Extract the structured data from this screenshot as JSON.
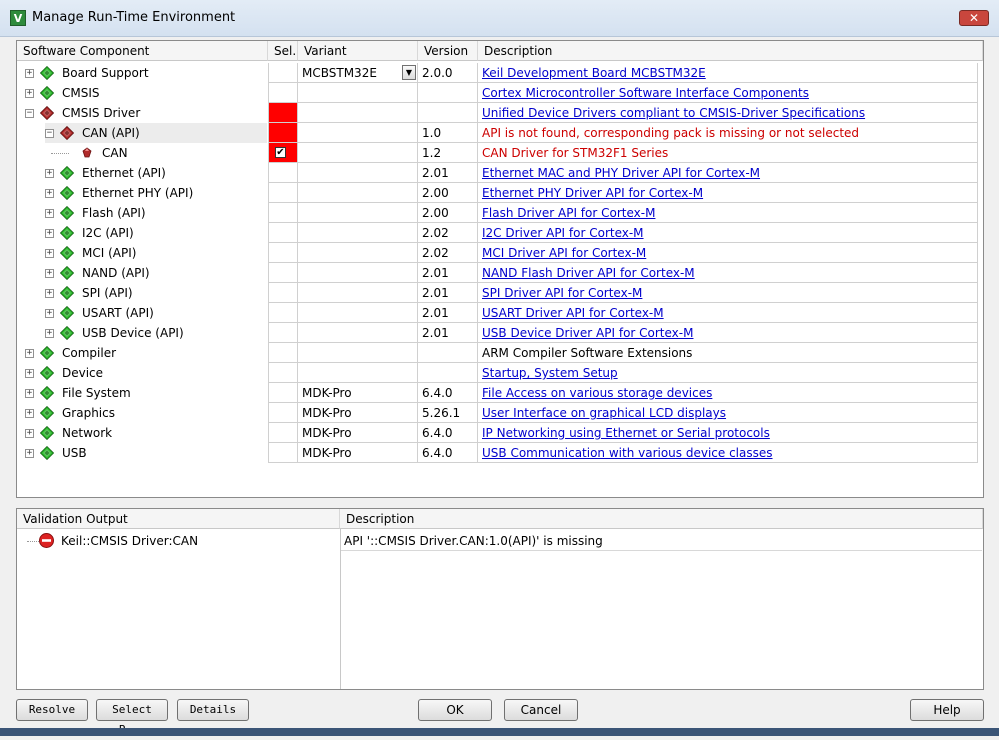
{
  "window": {
    "title": "Manage Run-Time Environment",
    "icon_letter": "V",
    "close_glyph": "✕"
  },
  "columns": {
    "component": "Software Component",
    "sel": "Sel.",
    "variant": "Variant",
    "version": "Version",
    "description": "Description"
  },
  "rows": [
    {
      "name": "Board Support",
      "level": 0,
      "expander": "+",
      "gem": "green",
      "variant": "MCBSTM32E",
      "has_combo": true,
      "version": "2.0.0",
      "description": "Keil Development Board MCBSTM32E",
      "desc_style": "link",
      "sel": ""
    },
    {
      "name": "CMSIS",
      "level": 0,
      "expander": "+",
      "gem": "green",
      "variant": "",
      "version": "",
      "description": "Cortex Microcontroller Software Interface Components",
      "desc_style": "link",
      "sel": ""
    },
    {
      "name": "CMSIS Driver",
      "level": 0,
      "expander": "−",
      "gem": "red",
      "variant": "",
      "version": "",
      "description": "Unified Device Drivers compliant to CMSIS-Driver Specifications",
      "desc_style": "link",
      "sel": "red"
    },
    {
      "name": "CAN (API)",
      "level": 1,
      "expander": "−",
      "gem": "red",
      "variant": "",
      "version": "1.0",
      "description": "API is not found, corresponding pack is missing or not selected",
      "desc_style": "error",
      "sel": "red",
      "highlight": true
    },
    {
      "name": "CAN",
      "level": 2,
      "expander": "",
      "gem": "small",
      "variant": "",
      "version": "1.2",
      "description": "CAN Driver for STM32F1 Series",
      "desc_style": "error",
      "sel": "check"
    },
    {
      "name": "Ethernet (API)",
      "level": 1,
      "expander": "+",
      "gem": "green",
      "variant": "",
      "version": "2.01",
      "description": "Ethernet MAC and PHY Driver API for Cortex-M",
      "desc_style": "link",
      "sel": ""
    },
    {
      "name": "Ethernet PHY (API)",
      "level": 1,
      "expander": "+",
      "gem": "green",
      "variant": "",
      "version": "2.00",
      "description": "Ethernet PHY Driver API for Cortex-M",
      "desc_style": "link",
      "sel": ""
    },
    {
      "name": "Flash (API)",
      "level": 1,
      "expander": "+",
      "gem": "green",
      "variant": "",
      "version": "2.00",
      "description": "Flash Driver API for Cortex-M",
      "desc_style": "link",
      "sel": ""
    },
    {
      "name": "I2C (API)",
      "level": 1,
      "expander": "+",
      "gem": "green",
      "variant": "",
      "version": "2.02",
      "description": "I2C Driver API for Cortex-M",
      "desc_style": "link",
      "sel": ""
    },
    {
      "name": "MCI (API)",
      "level": 1,
      "expander": "+",
      "gem": "green",
      "variant": "",
      "version": "2.02",
      "description": "MCI Driver API for Cortex-M",
      "desc_style": "link",
      "sel": ""
    },
    {
      "name": "NAND (API)",
      "level": 1,
      "expander": "+",
      "gem": "green",
      "variant": "",
      "version": "2.01",
      "description": "NAND Flash Driver API for Cortex-M",
      "desc_style": "link",
      "sel": ""
    },
    {
      "name": "SPI (API)",
      "level": 1,
      "expander": "+",
      "gem": "green",
      "variant": "",
      "version": "2.01",
      "description": "SPI Driver API for Cortex-M",
      "desc_style": "link",
      "sel": ""
    },
    {
      "name": "USART (API)",
      "level": 1,
      "expander": "+",
      "gem": "green",
      "variant": "",
      "version": "2.01",
      "description": "USART Driver API for Cortex-M",
      "desc_style": "link",
      "sel": ""
    },
    {
      "name": "USB Device (API)",
      "level": 1,
      "expander": "+",
      "gem": "green",
      "variant": "",
      "version": "2.01",
      "description": "USB Device Driver API for Cortex-M",
      "desc_style": "link",
      "sel": ""
    },
    {
      "name": "Compiler",
      "level": 0,
      "expander": "+",
      "gem": "green",
      "variant": "",
      "version": "",
      "description": "ARM Compiler Software Extensions",
      "desc_style": "plain",
      "sel": ""
    },
    {
      "name": "Device",
      "level": 0,
      "expander": "+",
      "gem": "green",
      "variant": "",
      "version": "",
      "description": "Startup, System Setup",
      "desc_style": "link",
      "sel": ""
    },
    {
      "name": "File System",
      "level": 0,
      "expander": "+",
      "gem": "green",
      "variant": "MDK-Pro",
      "version": "6.4.0",
      "description": "File Access on various storage devices",
      "desc_style": "link",
      "sel": ""
    },
    {
      "name": "Graphics",
      "level": 0,
      "expander": "+",
      "gem": "green",
      "variant": "MDK-Pro",
      "version": "5.26.1",
      "description": "User Interface on graphical LCD displays",
      "desc_style": "link",
      "sel": ""
    },
    {
      "name": "Network",
      "level": 0,
      "expander": "+",
      "gem": "green",
      "variant": "MDK-Pro",
      "version": "6.4.0",
      "description": "IP Networking using Ethernet or Serial protocols",
      "desc_style": "link",
      "sel": ""
    },
    {
      "name": "USB",
      "level": 0,
      "expander": "+",
      "gem": "green",
      "variant": "MDK-Pro",
      "version": "6.4.0",
      "description": "USB Communication with various device classes",
      "desc_style": "link",
      "sel": ""
    }
  ],
  "validation": {
    "col_output": "Validation Output",
    "col_description": "Description",
    "items": [
      {
        "name": "Keil::CMSIS Driver:CAN",
        "description": "API '::CMSIS Driver.CAN:1.0(API)' is missing"
      }
    ]
  },
  "buttons": {
    "resolve": "Resolve",
    "select_packs": "Select P...",
    "details": "Details",
    "ok": "OK",
    "cancel": "Cancel",
    "help": "Help"
  },
  "colors": {
    "link": "#0000cc",
    "error": "#cc0000",
    "sel_error": "#ff0000",
    "gem_green": "#2db82d",
    "gem_red": "#b02a2a"
  },
  "check_glyph": "✔",
  "combo_glyph": "▼"
}
